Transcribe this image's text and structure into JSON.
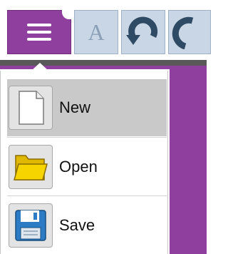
{
  "toolbar": {
    "menu_icon": "hamburger-menu-icon",
    "font_button_glyph": "A",
    "undo_icon": "undo-icon",
    "redo_icon": "redo-icon"
  },
  "file_menu": {
    "items": [
      {
        "label": "New",
        "icon": "new-document-icon",
        "selected": true
      },
      {
        "label": "Open",
        "icon": "folder-icon",
        "selected": false
      },
      {
        "label": "Save",
        "icon": "floppy-disk-icon",
        "selected": false
      }
    ]
  },
  "colors": {
    "accent_purple": "#8f3f9d",
    "toolbar_button_blue": "#c9d6e6",
    "selected_item_gray": "#c9c9c9"
  }
}
